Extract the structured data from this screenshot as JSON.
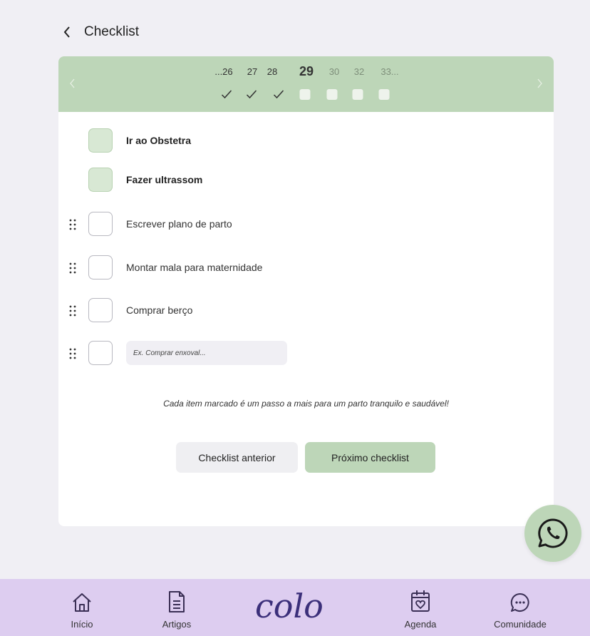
{
  "header": {
    "title": "Checklist"
  },
  "weeks": [
    {
      "label": "...26",
      "state": "done"
    },
    {
      "label": "27",
      "state": "done"
    },
    {
      "label": "28",
      "state": "done"
    },
    {
      "label": "29",
      "state": "current"
    },
    {
      "label": "30",
      "state": "future"
    },
    {
      "label": "32",
      "state": "future"
    },
    {
      "label": "33...",
      "state": "future"
    }
  ],
  "items": [
    {
      "label": "Ir ao Obstetra",
      "checked": true,
      "draggable": false
    },
    {
      "label": "Fazer ultrassom",
      "checked": true,
      "draggable": false
    },
    {
      "label": "Escrever plano de parto",
      "checked": false,
      "draggable": true
    },
    {
      "label": "Montar mala para maternidade",
      "checked": false,
      "draggable": true
    },
    {
      "label": "Comprar berço",
      "checked": false,
      "draggable": true
    }
  ],
  "new_item": {
    "placeholder": "Ex. Comprar enxoval..."
  },
  "motivation": "Cada item marcado é um passo a mais para um parto tranquilo e saudável!",
  "buttons": {
    "previous": "Checklist anterior",
    "next": "Próximo checklist"
  },
  "bottom_nav": {
    "items": [
      {
        "label": "Início",
        "icon": "home-icon"
      },
      {
        "label": "Artigos",
        "icon": "document-icon"
      },
      {
        "label": "Agenda",
        "icon": "calendar-heart-icon"
      },
      {
        "label": "Comunidade",
        "icon": "chat-bubble-icon"
      }
    ],
    "logo_text": "colo"
  },
  "colors": {
    "accent_green": "#bdd6b8",
    "nav_purple": "#ddcdf0",
    "background": "#f0eff4"
  }
}
